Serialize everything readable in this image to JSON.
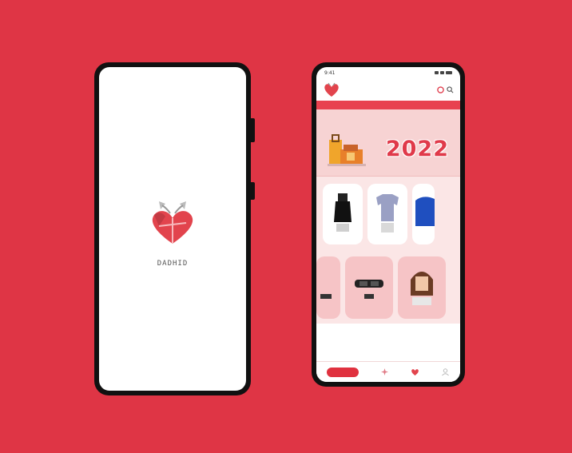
{
  "splash": {
    "brand": "DADHID",
    "logo_icon": "heart-gift-logo-icon"
  },
  "home": {
    "status_time": "9:41",
    "promo_strip": "",
    "banner": {
      "title": "",
      "subtitle": "",
      "year": "2022"
    },
    "sections": [
      {
        "label": ""
      },
      {
        "label": ""
      }
    ],
    "bottom_nav": {
      "home_label": "",
      "items": [
        "home-icon",
        "sparkle-icon",
        "heart-logo-icon",
        "profile-icon"
      ]
    }
  },
  "colors": {
    "background": "#df3545",
    "accent": "#e03a4a",
    "banner": "#f7d3d3",
    "section": "#fbe6e6"
  }
}
